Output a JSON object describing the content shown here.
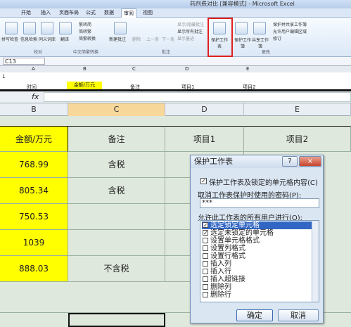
{
  "window": {
    "title": "药剂费对比 [兼容模式] - Microsoft Excel",
    "left_frag": "文"
  },
  "menu": {
    "tabs": [
      "开始",
      "插入",
      "页面布局",
      "公式",
      "数据",
      "审阅",
      "视图"
    ],
    "active": "审阅"
  },
  "ribbon": {
    "proofing": [
      "拼写检查",
      "信息检索",
      "同义词库",
      "翻译"
    ],
    "proofing_group": "校对",
    "chinese": [
      "繁转简",
      "简转繁",
      "简繁转换"
    ],
    "chinese_group": "中文简繁转换",
    "comments": [
      "新建批注",
      "删除",
      "上一条",
      "下一条"
    ],
    "comments_small": [
      "显示/隐藏批注",
      "显示所有批注",
      "显示墨迹"
    ],
    "comments_group": "批注",
    "protect_sheet": "保护工作表",
    "protect_wb": "保护工作簿",
    "share_wb": "共享工作簿",
    "changes_small": [
      "保护并共享工作簿",
      "允许用户编辑区域",
      "修订"
    ],
    "changes_group": "更改"
  },
  "top_formula": {
    "namebox": "C13"
  },
  "mini": {
    "cols": [
      "A",
      "B",
      "C",
      "D",
      "E"
    ],
    "row1": "1",
    "row2": [
      "时间",
      "金额/万元",
      "备注",
      "项目1",
      "项目2"
    ]
  },
  "fx": "fx",
  "sheet": {
    "cols": [
      "B",
      "C",
      "D",
      "E"
    ],
    "header": [
      "金额/万元",
      "备注",
      "项目1",
      "项目2"
    ],
    "rows": [
      {
        "b": "768.99",
        "c": "含税"
      },
      {
        "b": "805.34",
        "c": "含税"
      },
      {
        "b": "750.53",
        "c": ""
      },
      {
        "b": "1039",
        "c": ""
      },
      {
        "b": "888.03",
        "c": "不含税"
      }
    ]
  },
  "dialog": {
    "title": "保护工作表",
    "help": "?",
    "close": "×",
    "protect_label": "保护工作表及锁定的单元格内容(C)",
    "password_label": "取消工作表保护时使用的密码(P):",
    "password_value": "***",
    "allow_label": "允许此工作表的所有用户进行(O):",
    "items": [
      {
        "label": "选定锁定单元格",
        "checked": true
      },
      {
        "label": "选定未锁定的单元格",
        "checked": true
      },
      {
        "label": "设置单元格格式",
        "checked": false
      },
      {
        "label": "设置列格式",
        "checked": false
      },
      {
        "label": "设置行格式",
        "checked": false
      },
      {
        "label": "插入列",
        "checked": false
      },
      {
        "label": "插入行",
        "checked": false
      },
      {
        "label": "插入超链接",
        "checked": false
      },
      {
        "label": "删除列",
        "checked": false
      },
      {
        "label": "删除行",
        "checked": false
      }
    ],
    "ok": "确定",
    "cancel": "取消"
  }
}
